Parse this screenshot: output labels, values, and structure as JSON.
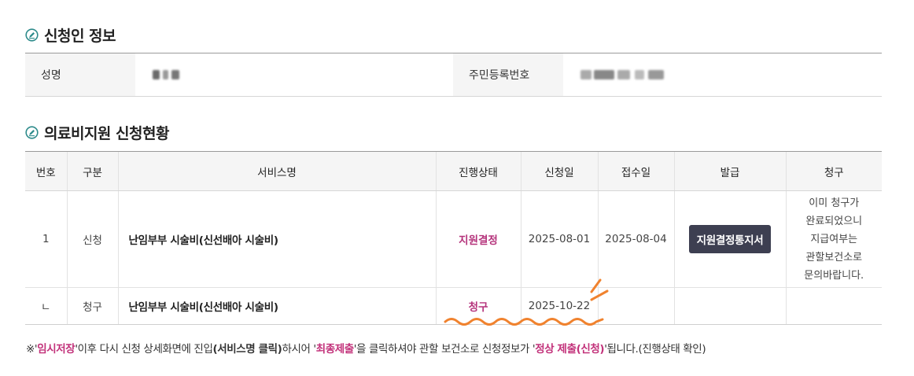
{
  "applicant_section": {
    "title": "신청인 정보",
    "name_label": "성명",
    "rrn_label": "주민등록번호"
  },
  "status_section": {
    "title": "의료비지원 신청현황",
    "columns": [
      "번호",
      "구분",
      "서비스명",
      "진행상태",
      "신청일",
      "접수일",
      "발급",
      "청구"
    ],
    "rows": [
      {
        "no": "1",
        "type": "신청",
        "service": "난임부부 시술비(신선배아 시술비)",
        "status": "지원결정",
        "apply_date": "2025-08-01",
        "receipt_date": "2025-08-04",
        "issue_button": "지원결정통지서",
        "claim_lines": [
          "이미 청구가",
          "완료되었으니",
          "지급여부는",
          "관할보건소로",
          "문의바랍니다."
        ]
      },
      {
        "no": "ㄴ",
        "type": "청구",
        "service": "난임부부 시술비(신선배아 시술비)",
        "status": "청구",
        "apply_date": "2025-10-22",
        "receipt_date": "",
        "issue_button": "",
        "claim_lines": []
      }
    ]
  },
  "notice": {
    "prefix": "※'",
    "temp_save": "임시저장",
    "part1": "'이후 다시 신청 상세화면에 진입",
    "service_click": "(서비스명 클릭)",
    "part2": "하시어 '",
    "final_submit": "최종제출",
    "part3": "'을 클릭하셔야 관할 보건소로 신청정보가 '",
    "normal_submit": "정상 제출(신청)",
    "part4": "'됩니다.(진행상태 확인)"
  },
  "colors": {
    "accent_pink": "#b5347c",
    "button_dark": "#3d3f51",
    "scribble_orange": "#f0822e",
    "icon_teal": "#2e8b8b"
  },
  "icons": [
    "pencil-circle-icon"
  ]
}
